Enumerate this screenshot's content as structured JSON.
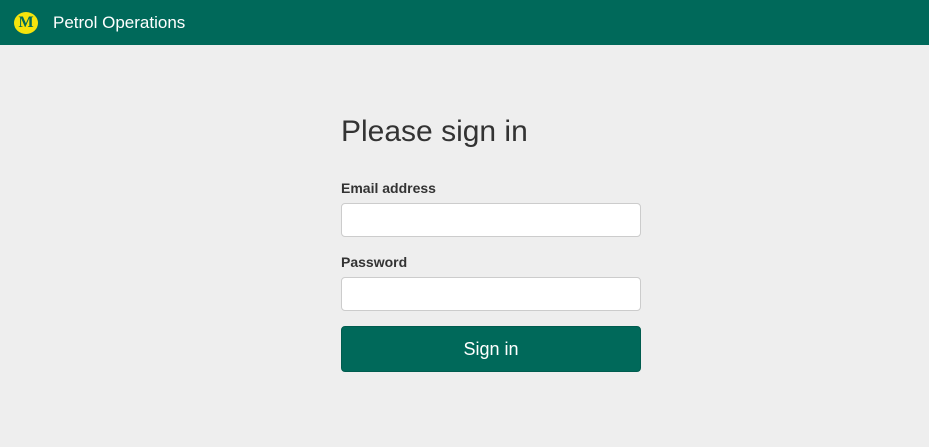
{
  "header": {
    "logo_letter": "M",
    "brand": "Petrol Operations"
  },
  "form": {
    "heading": "Please sign in",
    "email_label": "Email address",
    "email_value": "",
    "password_label": "Password",
    "password_value": "",
    "submit_label": "Sign in"
  },
  "colors": {
    "brand_green": "#00695a",
    "logo_yellow": "#f5e40c",
    "background": "#eeeeee"
  }
}
